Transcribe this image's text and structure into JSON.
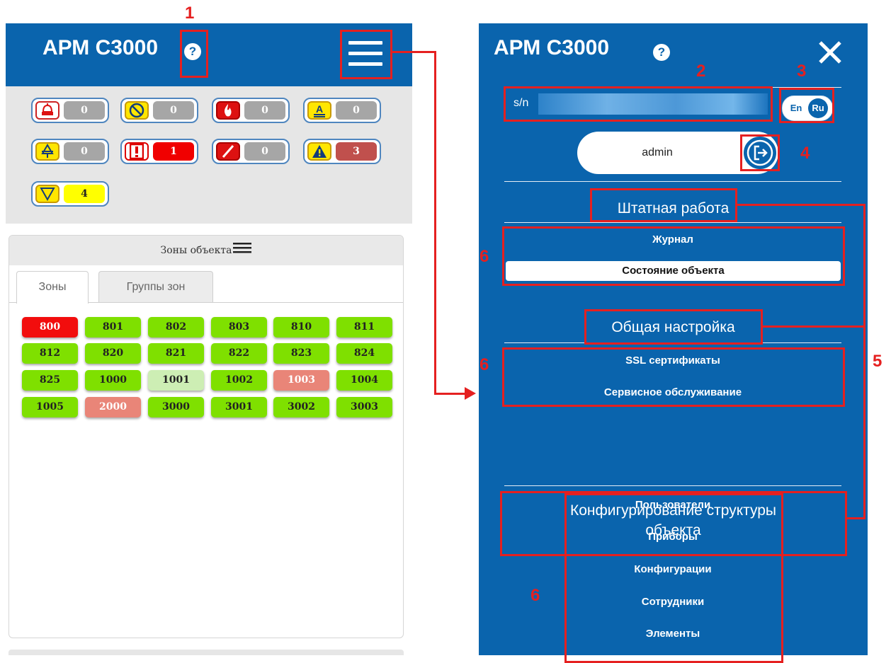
{
  "app": {
    "title": "АРМ С3000",
    "help_icon": "?",
    "menu_icon": "hamburger-icon"
  },
  "status_chips": [
    {
      "icon": "siren-alarm-icon",
      "value": "0",
      "value_color": "#a6a6a6"
    },
    {
      "icon": "disabled-icon",
      "value": "0",
      "value_color": "#a6a6a6"
    },
    {
      "icon": "fire-icon",
      "value": "0",
      "value_color": "#a6a6a6"
    },
    {
      "icon": "attention-icon",
      "value": "0",
      "value_color": "#a6a6a6"
    },
    {
      "icon": "arm-icon",
      "value": "0",
      "value_color": "#a6a6a6"
    },
    {
      "icon": "alarm-exclamation-icon",
      "value": "1",
      "value_color": "#f00000"
    },
    {
      "icon": "fault-icon",
      "value": "0",
      "value_color": "#a6a6a6"
    },
    {
      "icon": "warning-triangle-icon",
      "value": "3",
      "value_color": "#c0504d"
    },
    {
      "icon": "triangle-down-icon",
      "value": "4",
      "value_color": "#ffff00"
    }
  ],
  "zones_panel": {
    "title": "Зоны объекта",
    "tabs": [
      "Зоны",
      "Группы зон"
    ],
    "active_tab": "Зоны",
    "zones": [
      {
        "label": "800",
        "state": "red"
      },
      {
        "label": "801",
        "state": "green"
      },
      {
        "label": "802",
        "state": "green"
      },
      {
        "label": "803",
        "state": "green"
      },
      {
        "label": "810",
        "state": "green"
      },
      {
        "label": "811",
        "state": "green"
      },
      {
        "label": "812",
        "state": "green"
      },
      {
        "label": "820",
        "state": "green"
      },
      {
        "label": "821",
        "state": "green"
      },
      {
        "label": "822",
        "state": "green"
      },
      {
        "label": "823",
        "state": "green"
      },
      {
        "label": "824",
        "state": "green"
      },
      {
        "label": "825",
        "state": "green"
      },
      {
        "label": "1000",
        "state": "green"
      },
      {
        "label": "1001",
        "state": "pale"
      },
      {
        "label": "1002",
        "state": "green"
      },
      {
        "label": "1003",
        "state": "salmon"
      },
      {
        "label": "1004",
        "state": "green"
      },
      {
        "label": "1005",
        "state": "green"
      },
      {
        "label": "2000",
        "state": "salmon"
      },
      {
        "label": "3000",
        "state": "green"
      },
      {
        "label": "3001",
        "state": "green"
      },
      {
        "label": "3002",
        "state": "green"
      },
      {
        "label": "3003",
        "state": "green"
      }
    ]
  },
  "side_menu": {
    "title": "АРМ С3000",
    "serial_label": "s/n",
    "lang_en": "En",
    "lang_ru": "Ru",
    "user": "admin",
    "sections": [
      {
        "title": "Штатная работа",
        "items": [
          "Журнал",
          "Состояние объекта"
        ],
        "selected": "Состояние объекта"
      },
      {
        "title": "Общая настройка",
        "items": [
          "SSL сертификаты",
          "Сервисное обслуживание"
        ]
      },
      {
        "title_line1": "Конфигурирование структуры",
        "title_line2": "объекта",
        "items": [
          "Пользователи",
          "Приборы",
          "Конфигурации",
          "Сотрудники",
          "Элементы"
        ]
      }
    ]
  },
  "annotations": {
    "n1": "1",
    "n2": "2",
    "n3": "3",
    "n4": "4",
    "n5": "5",
    "n6": "6"
  },
  "colors": {
    "brand_blue": "#0a64ad",
    "annotation_red": "#e52020",
    "zone_green": "#7fe000",
    "zone_red": "#f20d0d",
    "zone_salmon": "#e98578",
    "zone_pale": "#cdeeb4"
  }
}
